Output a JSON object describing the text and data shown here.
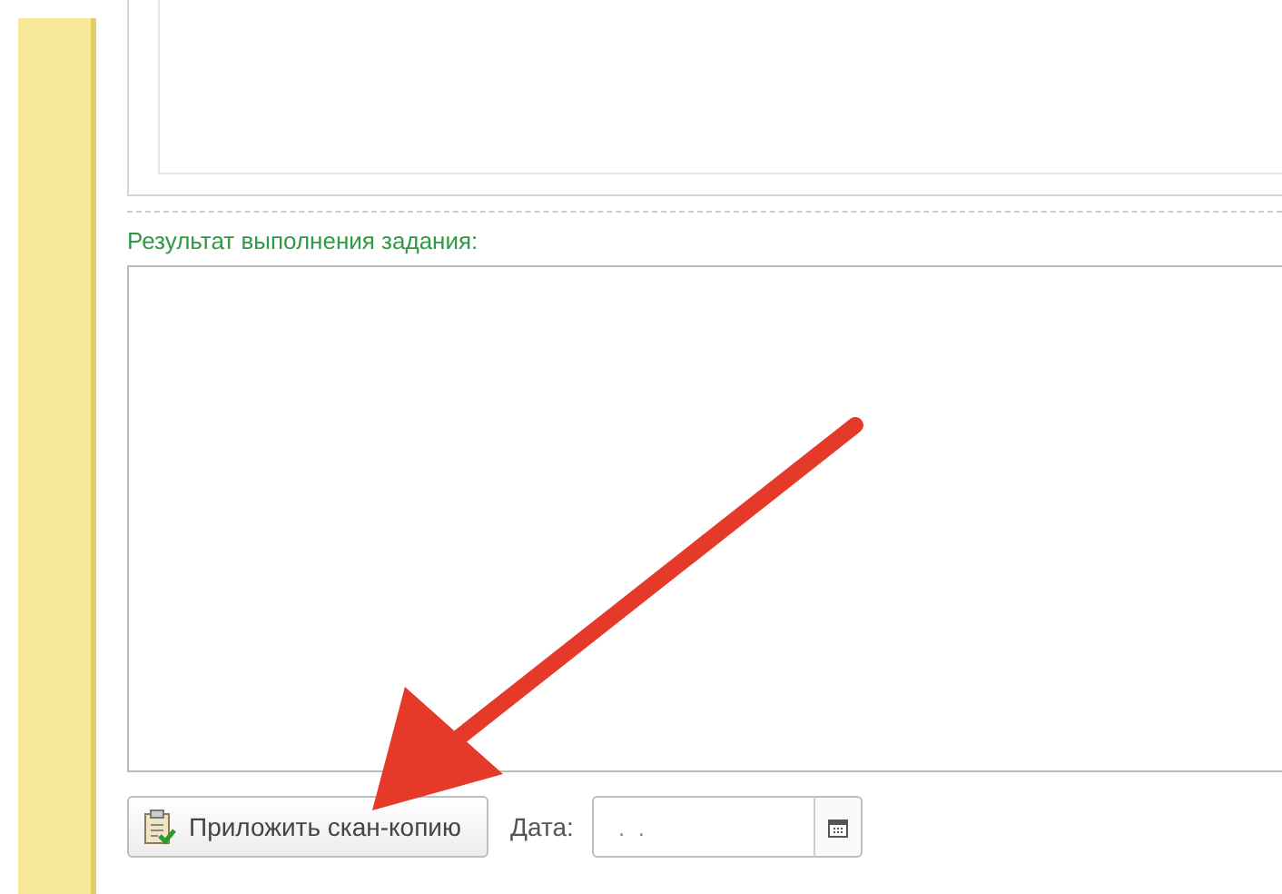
{
  "result_section": {
    "label": "Результат выполнения задания:"
  },
  "attach_button": {
    "label": "Приложить скан-копию"
  },
  "date_field": {
    "label": "Дата:",
    "value": " .  ."
  }
}
